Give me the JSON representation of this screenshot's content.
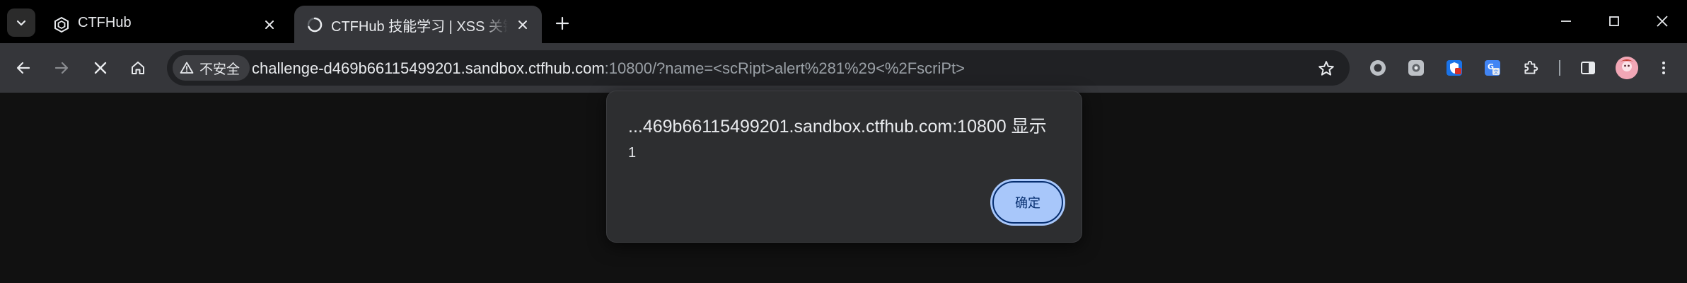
{
  "tabs": [
    {
      "title": "CTFHub",
      "favicon": "ctfhub-hexagon-icon",
      "active": false
    },
    {
      "title": "CTFHub 技能学习 | XSS 关键词过滤",
      "favicon": "loading-spinner-icon",
      "active": true
    }
  ],
  "toolbar": {
    "security_label": "不安全",
    "url_host": "challenge-d469b66115499201.sandbox.ctfhub.com",
    "url_rest": ":10800/?name=<scRipt>alert%281%29<%2FscriPt>"
  },
  "extensions": [
    "record-circle-icon",
    "camera-ext-icon",
    "shield-ext-icon",
    "translate-ext-icon",
    "puzzle-icon",
    "side-panel-icon"
  ],
  "dialog": {
    "title": "...469b66115499201.sandbox.ctfhub.com:10800 显示",
    "message": "1",
    "ok_label": "确定"
  },
  "colors": {
    "accent": "#a8c7fa",
    "accent_text": "#062e6f",
    "toolbar": "#35363a",
    "omnibox": "#202124",
    "page": "#111111"
  }
}
